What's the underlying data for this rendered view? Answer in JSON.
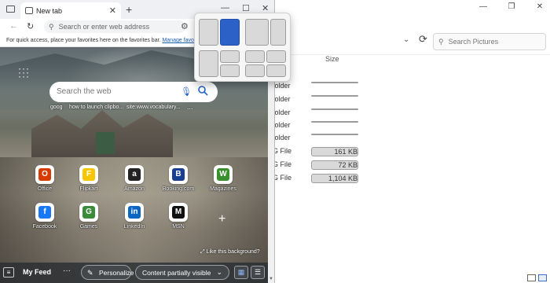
{
  "explorer": {
    "search_placeholder": "Search Pictures",
    "column_size": "Size",
    "rows": [
      {
        "type": "folder",
        "size": ""
      },
      {
        "type": "folder",
        "size": ""
      },
      {
        "type": "folder",
        "size": ""
      },
      {
        "type": "folder",
        "size": ""
      },
      {
        "type": "folder",
        "size": ""
      },
      {
        "type": "G File",
        "size": "161 KB"
      },
      {
        "type": "G File",
        "size": "72 KB"
      },
      {
        "type": "G File",
        "size": "1,104 KB"
      }
    ]
  },
  "browser": {
    "tab_title": "New tab",
    "address_placeholder": "Search or enter web address",
    "favorites_prompt": "For quick access, place your favorites here on the favorites bar.",
    "favorites_link": "Manage favorites",
    "search_placeholder": "Search the web",
    "quick_links": [
      "goog",
      "how to launch clipbo...",
      "site:www.vocabulary...",
      "..."
    ],
    "tiles": [
      {
        "label": "Office",
        "glyph": "O",
        "color": "#d83b01"
      },
      {
        "label": "Flipkart",
        "glyph": "F",
        "color": "#f7c600"
      },
      {
        "label": "Amazon",
        "glyph": "a",
        "color": "#222222"
      },
      {
        "label": "Booking.com",
        "glyph": "B",
        "color": "#1a3f8f"
      },
      {
        "label": "Magazines",
        "glyph": "W",
        "color": "#3a8f2f"
      },
      {
        "label": "Facebook",
        "glyph": "f",
        "color": "#1877f2"
      },
      {
        "label": "Games",
        "glyph": "G",
        "color": "#3b8b3b"
      },
      {
        "label": "LinkedIn",
        "glyph": "in",
        "color": "#0a66c2"
      },
      {
        "label": "MSN",
        "glyph": "M",
        "color": "#111111"
      }
    ],
    "like_background": "Like this background?",
    "feed": {
      "my_feed": "My Feed",
      "personalize": "Personalize",
      "content_visibility": "Content partially visible"
    }
  },
  "icons": {
    "sidebar": "sidebar-icon",
    "tab": "tab-page-icon",
    "close": "close-icon",
    "add": "plus-icon",
    "minimize": "minimize-icon",
    "maximize": "maximize-icon",
    "back": "back-arrow-icon",
    "refresh": "refresh-icon",
    "search": "search-icon",
    "microphone": "microphone-icon",
    "apps_grid": "apps-grid-icon",
    "snap_layouts": "snap-layouts-icon"
  },
  "colors": {
    "accent": "#2c62c7",
    "link": "#1a5fb4"
  }
}
